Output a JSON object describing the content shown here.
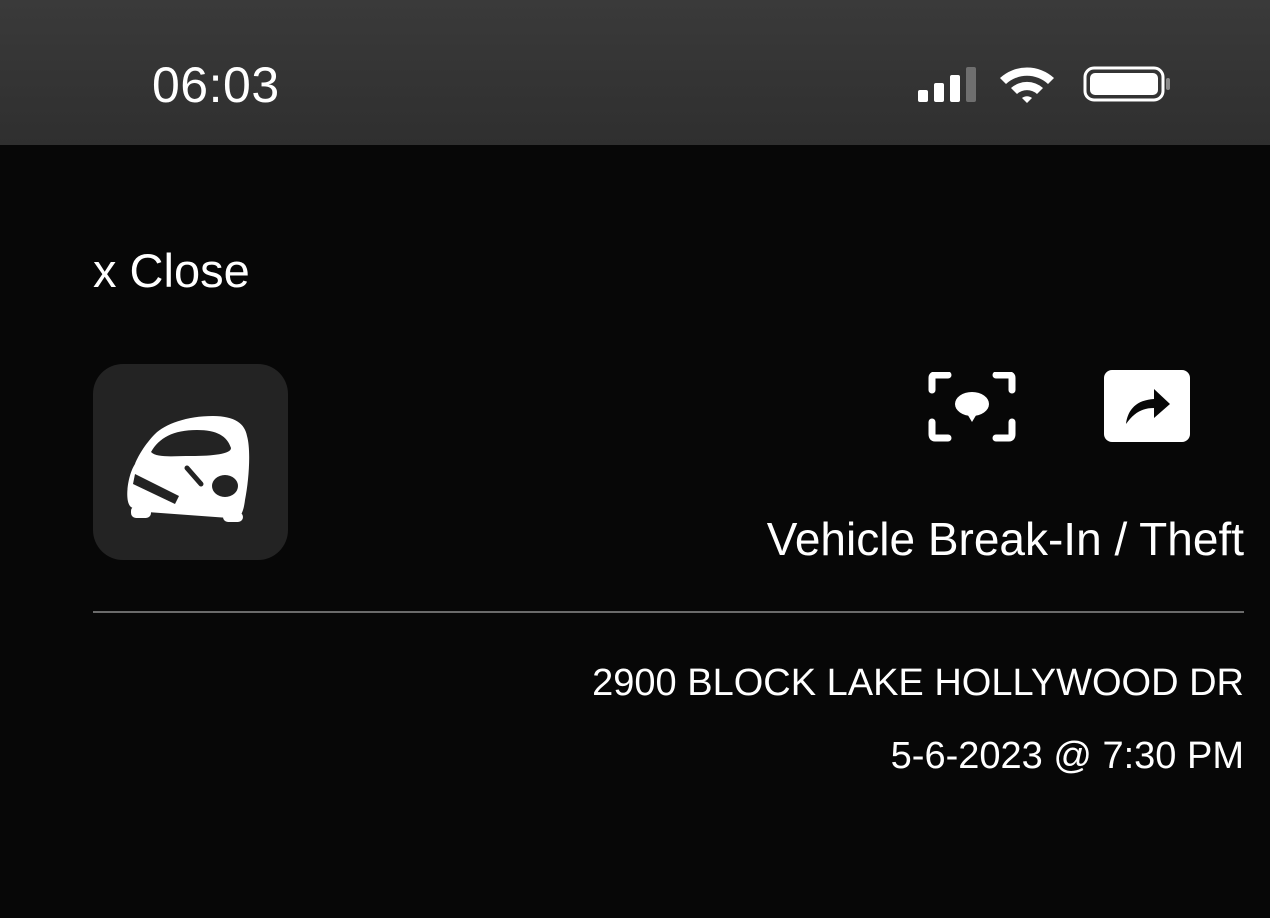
{
  "status_bar": {
    "time": "06:03",
    "icons": [
      "cellular-signal-icon",
      "wifi-icon",
      "battery-icon"
    ]
  },
  "close_label": "x Close",
  "incident": {
    "category_icon": "car-break-in-icon",
    "type": "Vehicle Break-In / Theft",
    "address": "2900 BLOCK LAKE HOLLYWOOD DR",
    "datetime": "5-6-2023 @ 7:30 PM"
  },
  "actions": [
    {
      "name": "comment",
      "icon": "comment-focus-icon"
    },
    {
      "name": "share",
      "icon": "share-icon"
    }
  ],
  "colors": {
    "background": "#070707",
    "status_bar": "#333333",
    "tile": "#232323",
    "text": "#ffffff",
    "divider": "#6a6a6a"
  }
}
